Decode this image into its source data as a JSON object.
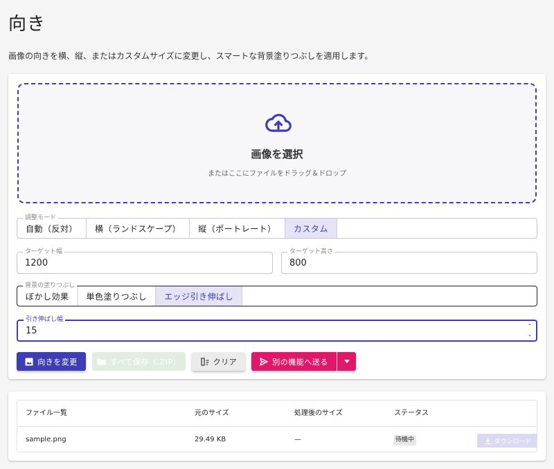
{
  "page": {
    "title": "向き",
    "description": "画像の向きを横、縦、またはカスタムサイズに変更し、スマートな背景塗りつぶしを適用します。"
  },
  "dropzone": {
    "title": "画像を選択",
    "subtitle": "またはここにファイルをドラッグ＆ドロップ",
    "icon": "cloud-upload-icon"
  },
  "mode": {
    "legend": "調整モード",
    "options": [
      "自動（反対）",
      "横（ランドスケープ）",
      "縦（ポートレート）",
      "カスタム"
    ],
    "selected": "カスタム"
  },
  "target_width": {
    "legend": "ターゲット幅",
    "value": "1200"
  },
  "target_height": {
    "legend": "ターゲット高さ",
    "value": "800"
  },
  "background_fill": {
    "legend": "背景の塗りつぶし",
    "options": [
      "ぼかし効果",
      "単色塗りつぶし",
      "エッジ引き伸ばし"
    ],
    "selected": "エッジ引き伸ばし"
  },
  "stretch_width": {
    "legend": "引き伸ばし幅",
    "value": "15"
  },
  "actions": {
    "rotate": "向きを変更",
    "save_all": "すべて保存（.ZIP）",
    "clear": "クリア",
    "send": "別の機能へ送る"
  },
  "file_table": {
    "headers": [
      "ファイル一覧",
      "元のサイズ",
      "処理後のサイズ",
      "ステータス"
    ],
    "rows": [
      {
        "name": "sample.png",
        "original_size": "29.49 KB",
        "processed_size": "—",
        "status": "待機中",
        "action": "ダウンロード"
      }
    ]
  },
  "colors": {
    "primary": "#3f3db3",
    "accent": "#e0176b",
    "background": "#f5f5f5"
  }
}
